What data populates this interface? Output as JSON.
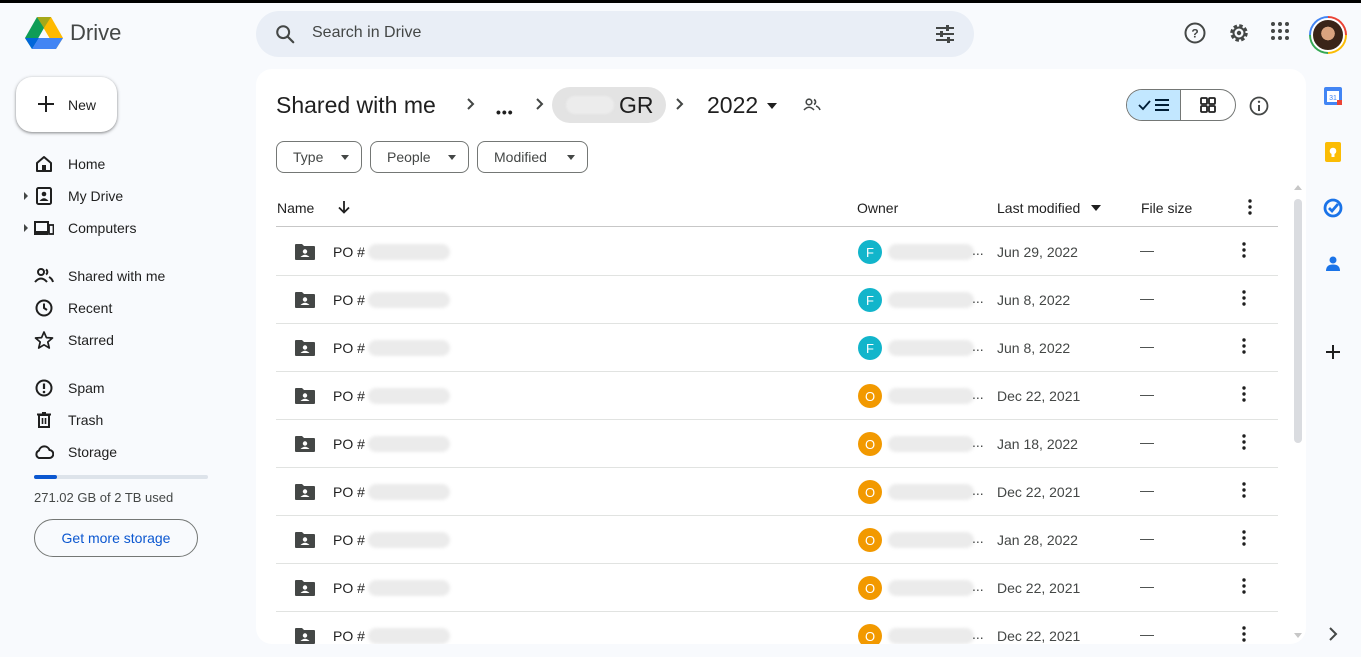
{
  "app": {
    "name": "Drive"
  },
  "search": {
    "placeholder": "Search in Drive"
  },
  "sidebar": {
    "new_label": "New",
    "items": [
      {
        "label": "Home",
        "icon": "home-icon"
      },
      {
        "label": "My Drive",
        "icon": "my-drive-icon"
      },
      {
        "label": "Computers",
        "icon": "computers-icon"
      },
      {
        "label": "Shared with me",
        "icon": "shared-icon"
      },
      {
        "label": "Recent",
        "icon": "clock-icon"
      },
      {
        "label": "Starred",
        "icon": "star-icon"
      },
      {
        "label": "Spam",
        "icon": "spam-icon"
      },
      {
        "label": "Trash",
        "icon": "trash-icon"
      },
      {
        "label": "Storage",
        "icon": "cloud-icon"
      }
    ],
    "storage_used_fraction": 0.13,
    "storage_text": "271.02 GB of 2 TB used",
    "get_storage_label": "Get more storage"
  },
  "breadcrumb": {
    "root": "Shared with me",
    "ellipsis": "•••",
    "folder": "GR",
    "current": "2022"
  },
  "filters": [
    "Type",
    "People",
    "Modified"
  ],
  "table": {
    "headers": {
      "name": "Name",
      "owner": "Owner",
      "last_modified": "Last modified",
      "file_size": "File size"
    },
    "rows": [
      {
        "name": "PO #",
        "owner_initial": "F",
        "owner_color": "#12b5cb",
        "modified": "Jun 29, 2022",
        "size": "—"
      },
      {
        "name": "PO #",
        "owner_initial": "F",
        "owner_color": "#12b5cb",
        "modified": "Jun 8, 2022",
        "size": "—"
      },
      {
        "name": "PO #",
        "owner_initial": "F",
        "owner_color": "#12b5cb",
        "modified": "Jun 8, 2022",
        "size": "—"
      },
      {
        "name": "PO #",
        "owner_initial": "O",
        "owner_color": "#f29900",
        "modified": "Dec 22, 2021",
        "size": "—"
      },
      {
        "name": "PO #",
        "owner_initial": "O",
        "owner_color": "#f29900",
        "modified": "Jan 18, 2022",
        "size": "—"
      },
      {
        "name": "PO #",
        "owner_initial": "O",
        "owner_color": "#f29900",
        "modified": "Dec 22, 2021",
        "size": "—"
      },
      {
        "name": "PO #",
        "owner_initial": "O",
        "owner_color": "#f29900",
        "modified": "Jan 28, 2022",
        "size": "—"
      },
      {
        "name": "PO #",
        "owner_initial": "O",
        "owner_color": "#f29900",
        "modified": "Dec 22, 2021",
        "size": "—"
      },
      {
        "name": "PO #",
        "owner_initial": "O",
        "owner_color": "#f29900",
        "modified": "Dec 22, 2021",
        "size": "—"
      }
    ]
  },
  "colors": {
    "accent": "#0b57d0",
    "selected_toggle": "#c2e7ff",
    "background": "#f8fafd"
  }
}
